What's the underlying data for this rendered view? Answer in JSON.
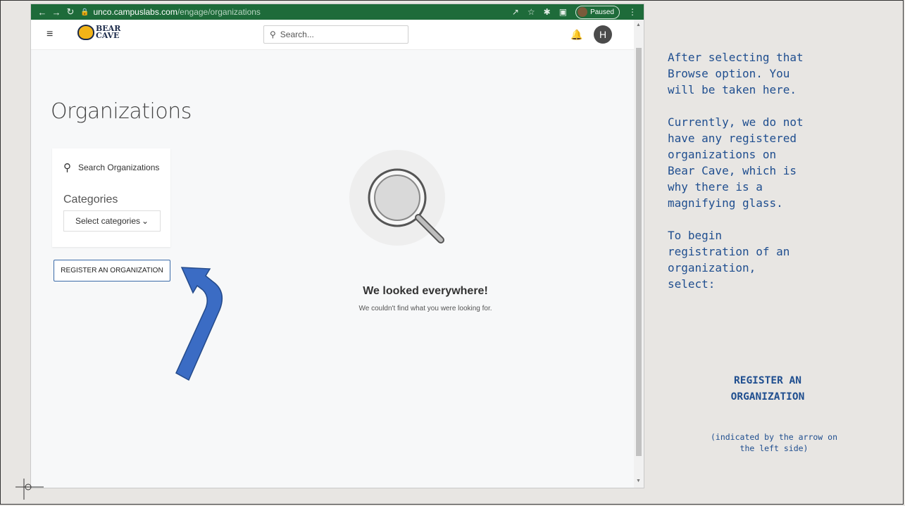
{
  "browser": {
    "url_host": "unco.campuslabs.com",
    "url_path": "/engage/organizations",
    "profile_status": "Paused"
  },
  "app": {
    "logo_line1": "BEAR",
    "logo_line2": "CAVE",
    "search_placeholder": "Search...",
    "user_initial": "H"
  },
  "page": {
    "title": "Organizations",
    "search_organizations": "Search Organizations",
    "categories_label": "Categories",
    "categories_select": "Select categories",
    "register_button": "REGISTER AN ORGANIZATION",
    "empty_title": "We looked everywhere!",
    "empty_subtitle": "We couldn't find what you were looking for."
  },
  "instructions": {
    "body": "After selecting that\nBrowse option. You\nwill be taken here.\n\nCurrently, we do not\nhave any registered\norganizations on\nBear Cave, which is\nwhy there is a\nmagnifying glass.\n\nTo begin\nregistration of an\norganization,\nselect:",
    "action": "REGISTER AN\nORGANIZATION",
    "note": "(indicated by the arrow on\nthe left side)"
  },
  "colors": {
    "chrome_green": "#1e6b3a",
    "annotation_blue": "#1f4e8f",
    "arrow_blue": "#3b6cc4"
  }
}
